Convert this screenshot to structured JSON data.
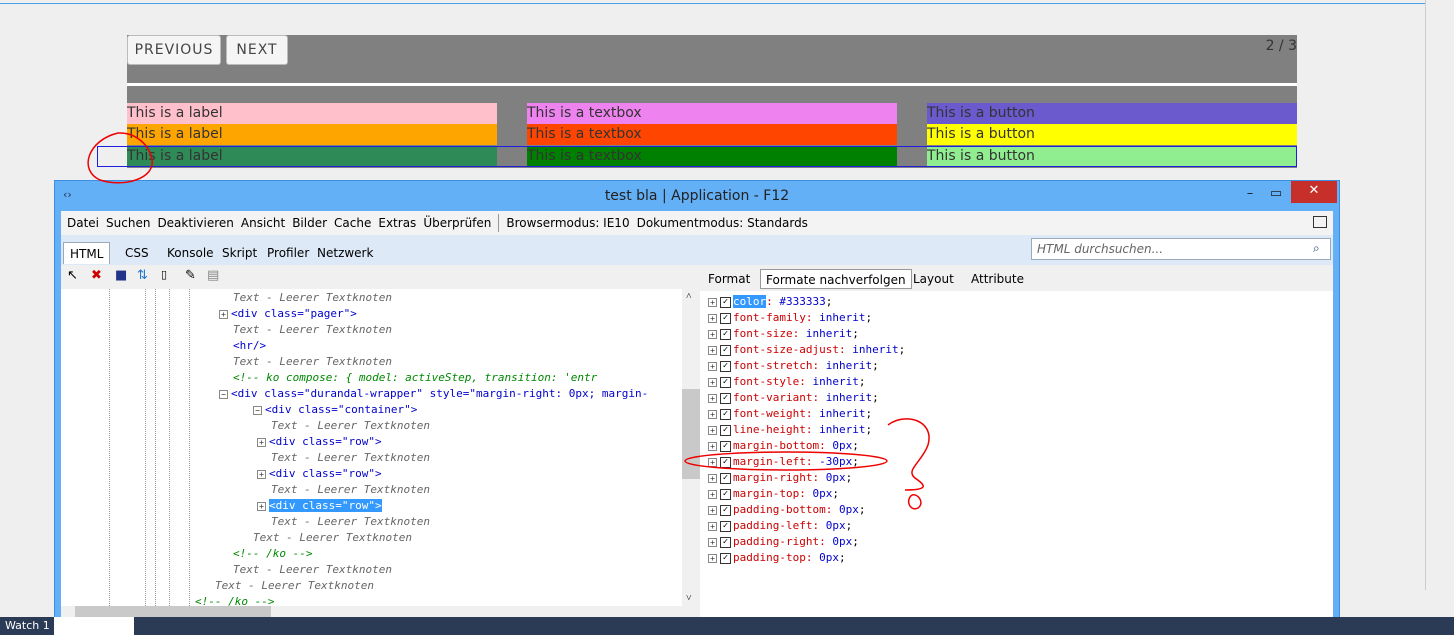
{
  "page": {
    "previous": "PREVIOUS",
    "next": "NEXT",
    "page_indicator": "2 / 3",
    "rows": [
      {
        "label": "This is a label",
        "textbox": "This is a textbox",
        "button": "This is a button",
        "colors": [
          "#ffc0cb",
          "#ee82ee",
          "#6a5acd"
        ]
      },
      {
        "label": "This is a label",
        "textbox": "This is a textbox",
        "button": "This is a button",
        "colors": [
          "#ffa500",
          "#ff4500",
          "#ffff00"
        ]
      },
      {
        "label": "This is a label",
        "textbox": "This is a textbox",
        "button": "This is a button",
        "colors": [
          "#2e8b57",
          "#008000",
          "#90ee90"
        ]
      }
    ]
  },
  "devtools": {
    "title": "test bla | Application - F12",
    "menu": [
      "Datei",
      "Suchen",
      "Deaktivieren",
      "Ansicht",
      "Bilder",
      "Cache",
      "Extras",
      "Überprüfen",
      "Browsermodus: IE10",
      "Dokumentmodus: Standards"
    ],
    "tabs": [
      "HTML",
      "CSS",
      "Konsole",
      "Skript",
      "Profiler",
      "Netzwerk"
    ],
    "search_placeholder": "HTML durchsuchen...",
    "right_tabs": [
      "Format",
      "Formate nachverfolgen",
      "Layout",
      "Attribute"
    ],
    "tree": [
      "Text - Leerer Textknoten",
      "<div class=\"pager\">",
      "Text - Leerer Textknoten",
      "<hr/>",
      "Text - Leerer Textknoten",
      "<!--  ko compose: { model: activeStep,        transition: 'entr",
      "<div class=\"durandal-wrapper\" style=\"margin-right: 0px; margin-",
      "<div class=\"container\">",
      "Text - Leerer Textknoten",
      "<div class=\"row\">",
      "Text - Leerer Textknoten",
      "<div class=\"row\">",
      "Text - Leerer Textknoten",
      "<div class=\"row\">",
      "Text - Leerer Textknoten",
      "Text - Leerer Textknoten",
      "<!--  /ko  -->",
      "Text - Leerer Textknoten",
      "Text - Leerer Textknoten",
      "<!-- /ko -->"
    ],
    "styles": [
      {
        "name": "color",
        "value": "#333333"
      },
      {
        "name": "font-family",
        "value": "inherit"
      },
      {
        "name": "font-size",
        "value": "inherit"
      },
      {
        "name": "font-size-adjust",
        "value": "inherit"
      },
      {
        "name": "font-stretch",
        "value": "inherit"
      },
      {
        "name": "font-style",
        "value": "inherit"
      },
      {
        "name": "font-variant",
        "value": "inherit"
      },
      {
        "name": "font-weight",
        "value": "inherit"
      },
      {
        "name": "line-height",
        "value": "inherit"
      },
      {
        "name": "margin-bottom",
        "value": "0px"
      },
      {
        "name": "margin-left",
        "value": "-30px"
      },
      {
        "name": "margin-right",
        "value": "0px"
      },
      {
        "name": "margin-top",
        "value": "0px"
      },
      {
        "name": "padding-bottom",
        "value": "0px"
      },
      {
        "name": "padding-left",
        "value": "0px"
      },
      {
        "name": "padding-right",
        "value": "0px"
      },
      {
        "name": "padding-top",
        "value": "0px"
      }
    ]
  },
  "taskbar": {
    "watch": "Watch 1"
  }
}
